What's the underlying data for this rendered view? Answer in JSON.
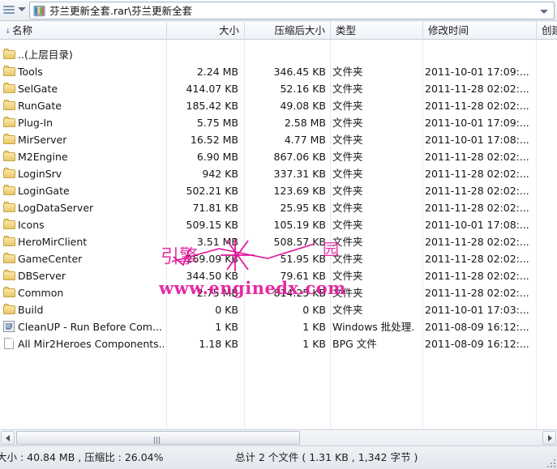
{
  "window": {
    "menu_icon": "hamburger-menu-icon",
    "menu_caret_icon": "chevron-down-icon",
    "archive_icon": "rar-archive-icon",
    "address_value": "芬兰更新全套.rar\\芬兰更新全套",
    "address_caret_icon": "chevron-down-icon"
  },
  "columns": [
    {
      "key": "name",
      "label": "名称",
      "sort": "↓"
    },
    {
      "key": "size",
      "label": "大小"
    },
    {
      "key": "packed",
      "label": "压缩后大小"
    },
    {
      "key": "type",
      "label": "类型"
    },
    {
      "key": "modified",
      "label": "修改时间"
    },
    {
      "key": "created",
      "label": "创建"
    }
  ],
  "rows": [
    {
      "icon": "folder-icon",
      "name": "..(上层目录)",
      "size": "",
      "packed": "",
      "type": "",
      "modified": ""
    },
    {
      "icon": "folder-icon",
      "name": "Tools",
      "size": "2.24 MB",
      "packed": "346.45 KB",
      "type": "文件夹",
      "modified": "2011-10-01 17:09:..."
    },
    {
      "icon": "folder-icon",
      "name": "SelGate",
      "size": "414.07 KB",
      "packed": "52.16 KB",
      "type": "文件夹",
      "modified": "2011-11-28 02:02:..."
    },
    {
      "icon": "folder-icon",
      "name": "RunGate",
      "size": "185.42 KB",
      "packed": "49.08 KB",
      "type": "文件夹",
      "modified": "2011-11-28 02:02:..."
    },
    {
      "icon": "folder-icon",
      "name": "Plug-In",
      "size": "5.75 MB",
      "packed": "2.58 MB",
      "type": "文件夹",
      "modified": "2011-10-01 17:09:..."
    },
    {
      "icon": "folder-icon",
      "name": "MirServer",
      "size": "16.52 MB",
      "packed": "4.77 MB",
      "type": "文件夹",
      "modified": "2011-10-01 17:08:..."
    },
    {
      "icon": "folder-icon",
      "name": "M2Engine",
      "size": "6.90 MB",
      "packed": "867.06 KB",
      "type": "文件夹",
      "modified": "2011-11-28 02:02:..."
    },
    {
      "icon": "folder-icon",
      "name": "LoginSrv",
      "size": "942 KB",
      "packed": "337.31 KB",
      "type": "文件夹",
      "modified": "2011-11-28 02:02:..."
    },
    {
      "icon": "folder-icon",
      "name": "LoginGate",
      "size": "502.21 KB",
      "packed": "123.69 KB",
      "type": "文件夹",
      "modified": "2011-11-28 02:02:..."
    },
    {
      "icon": "folder-icon",
      "name": "LogDataServer",
      "size": "71.81 KB",
      "packed": "25.95 KB",
      "type": "文件夹",
      "modified": "2011-11-28 02:02:..."
    },
    {
      "icon": "folder-icon",
      "name": "Icons",
      "size": "509.15 KB",
      "packed": "105.19 KB",
      "type": "文件夹",
      "modified": "2011-10-01 17:08:..."
    },
    {
      "icon": "folder-icon",
      "name": "HeroMirClient",
      "size": "3.51 MB",
      "packed": "508.57 KB",
      "type": "文件夹",
      "modified": "2011-11-28 02:02:..."
    },
    {
      "icon": "folder-icon",
      "name": "GameCenter",
      "size": "269.09 KB",
      "packed": "51.95 KB",
      "type": "文件夹",
      "modified": "2011-11-28 02:02:..."
    },
    {
      "icon": "folder-icon",
      "name": "DBServer",
      "size": "344.50 KB",
      "packed": "79.61 KB",
      "type": "文件夹",
      "modified": "2011-11-28 02:02:..."
    },
    {
      "icon": "folder-icon",
      "name": "Common",
      "size": "2.75 MB",
      "packed": "814.25 KB",
      "type": "文件夹",
      "modified": "2011-11-28 02:02:..."
    },
    {
      "icon": "folder-icon",
      "name": "Build",
      "size": "0 KB",
      "packed": "0 KB",
      "type": "文件夹",
      "modified": "2011-10-01 17:03:..."
    },
    {
      "icon": "bat-file-icon",
      "name": "CleanUP - Run Before Com...",
      "size": "1 KB",
      "packed": "1 KB",
      "type": "Windows 批处理...",
      "modified": "2011-08-09 16:12:..."
    },
    {
      "icon": "generic-file-icon",
      "name": "All Mir2Heroes Components...",
      "size": "1.18 KB",
      "packed": "1 KB",
      "type": "BPG 文件",
      "modified": "2011-08-09 16:12:..."
    }
  ],
  "watermark": {
    "url": "www.enginedx.com",
    "mark_left": "引擎",
    "mark_right": "园"
  },
  "scrollbar": {
    "left_arrow_icon": "scroll-left-arrow-icon",
    "right_arrow_icon": "scroll-right-arrow-icon",
    "grip_icon": "scroll-thumb-grip-icon"
  },
  "statusbar": {
    "left_text": "大小 : 40.84 MB , 压缩比 : 26.04%",
    "right_text": "总计 2 个文件 ( 1.31 KB , 1,342 字节 )",
    "resizer_icon": "resize-grip-icon"
  },
  "colors": {
    "accent": "#4a7fbf",
    "watermark": "#e4189b",
    "folder": "#e8c86a"
  }
}
